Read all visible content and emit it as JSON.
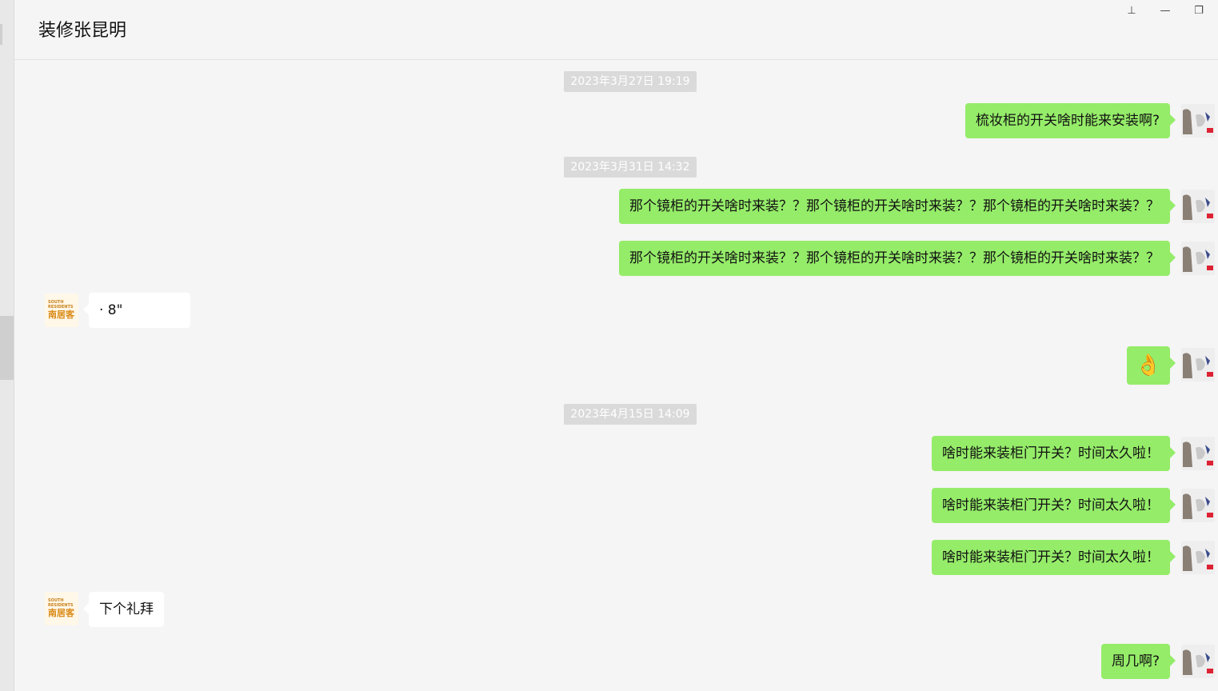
{
  "window": {
    "title": "装修张昆明",
    "controls": [
      {
        "name": "pin-icon",
        "glyph": "⊥"
      },
      {
        "name": "minimize-icon",
        "glyph": "—"
      },
      {
        "name": "restore-icon",
        "glyph": "❐"
      }
    ]
  },
  "colors": {
    "my_bubble": "#95ec69",
    "their_bubble": "#ffffff",
    "background": "#f5f5f5",
    "timestamp_bg": "#dadada"
  },
  "timestamps": [
    "2023年3月27日 19:19",
    "2023年3月31日 14:32",
    "2023年4月15日 14:09"
  ],
  "messages": [
    {
      "side": "me",
      "text": "梳妆柜的开关啥时能来安装啊?"
    },
    {
      "side": "me",
      "text": "那个镜柜的开关啥时来装？？那个镜柜的开关啥时来装？？那个镜柜的开关啥时来装？？"
    },
    {
      "side": "me",
      "text": "那个镜柜的开关啥时来装？？那个镜柜的开关啥时来装？？那个镜柜的开关啥时来装？？"
    },
    {
      "side": "them",
      "text": "·    8\""
    },
    {
      "side": "me",
      "text": "👌",
      "emoji": "ok-hand"
    },
    {
      "side": "me",
      "text": "啥时能来装柜门开关？时间太久啦！"
    },
    {
      "side": "me",
      "text": "啥时能来装柜门开关？时间太久啦！"
    },
    {
      "side": "me",
      "text": "啥时能来装柜门开关？时间太久啦！"
    },
    {
      "side": "them",
      "text": "下个礼拜"
    },
    {
      "side": "me",
      "text": "周几啊?"
    }
  ],
  "contact_avatar": {
    "top_text": "SOUTH",
    "mid_text": "RESIDENTS",
    "brand": "南居客"
  }
}
